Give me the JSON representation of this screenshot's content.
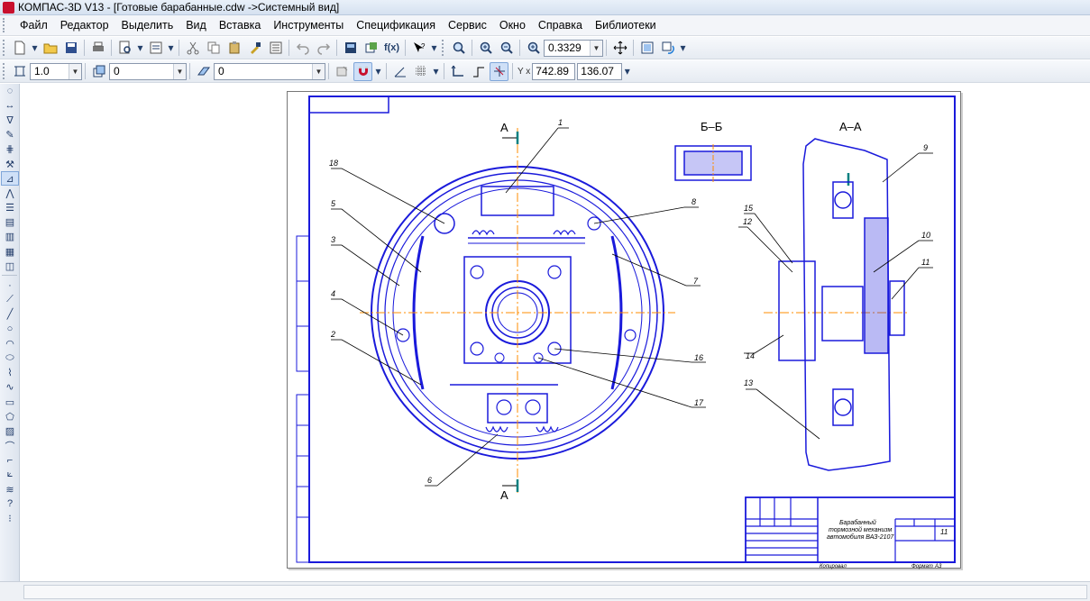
{
  "window": {
    "title": "КОМПАС-3D V13 - [Готовые барабанные.cdw ->Системный вид]"
  },
  "menu": {
    "items": [
      "Файл",
      "Редактор",
      "Выделить",
      "Вид",
      "Вставка",
      "Инструменты",
      "Спецификация",
      "Сервис",
      "Окно",
      "Справка",
      "Библиотеки"
    ]
  },
  "toolbar1": {
    "zoom_value": "0.3329",
    "fx_label": "f(x)"
  },
  "toolbar2": {
    "scale_value": "1.0",
    "layer_value": "0",
    "style_value": "0",
    "coord_x": "742.89",
    "coord_y": "136.07",
    "coord_label": "Y x"
  },
  "drawing": {
    "view_a_top": "A",
    "view_a_bottom": "A",
    "section_bb": "Б–Б",
    "section_aa": "А–А",
    "callouts": [
      "1",
      "2",
      "3",
      "4",
      "5",
      "6",
      "7",
      "8",
      "9",
      "10",
      "11",
      "12",
      "13",
      "14",
      "15",
      "16",
      "17",
      "18"
    ],
    "title_block": {
      "name_line1": "Барабанный",
      "name_line2": "тормозной механизм",
      "name_line3": "автомобиля ВАЗ-2107",
      "sheet_num": "11",
      "format_label": "Формат",
      "format_value": "А3",
      "copied_label": "Копировал"
    }
  },
  "colors": {
    "drawing_line": "#1a1adb",
    "axis_line": "#ff8c00",
    "section_mark": "#008080",
    "callout_line": "#000000"
  },
  "status": {
    "text": ""
  }
}
